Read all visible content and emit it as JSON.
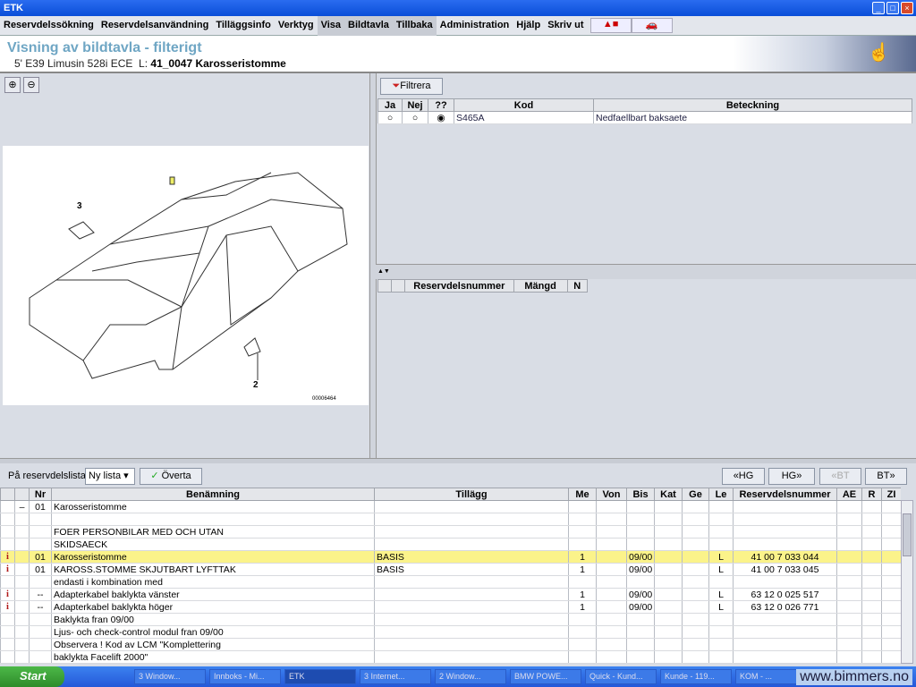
{
  "window": {
    "title": "ETK",
    "icon": "etk-app-icon"
  },
  "menu": [
    "Reservdelssökning",
    "Reservdelsanvändning",
    "Tilläggsinfo",
    "Verktyg",
    "Visa",
    "Bildtavla",
    "Tillbaka",
    "Administration",
    "Hjälp",
    "Skriv ut"
  ],
  "menu_highlighted": [
    "Visa",
    "Bildtavla",
    "Tillbaka"
  ],
  "toolbar_icons": [
    "warning-icon",
    "car-icon"
  ],
  "header": {
    "title": "Visning av bildtavla - filterigt",
    "model": "5' E39 Limusin 528i ECE",
    "group_prefix": "L:",
    "group": "41_0047 Karosseristomme"
  },
  "image": {
    "callouts": [
      "3",
      "2"
    ],
    "ref": "00006464"
  },
  "filter": {
    "button": "Filtrera",
    "columns": [
      "Ja",
      "Nej",
      "??",
      "Kod",
      "Beteckning"
    ],
    "rows": [
      {
        "selected": "??",
        "kod": "S465A",
        "beteckning": "Nedfaellbart baksaete"
      }
    ]
  },
  "parts_mini": {
    "columns": [
      "",
      "",
      "Reservdelsnummer",
      "Mängd",
      "N"
    ]
  },
  "bottom_toolbar": {
    "label": "På reservdelslista",
    "select": "Ny lista",
    "accept": "Överta",
    "nav": [
      "«HG",
      "HG»",
      "«BT",
      "BT»"
    ],
    "nav_disabled": [
      "«BT"
    ]
  },
  "table": {
    "columns": [
      "",
      "",
      "Nr",
      "Benämning",
      "Tillägg",
      "Me",
      "Von",
      "Bis",
      "Kat",
      "Ge",
      "Le",
      "Reservdelsnummer",
      "AE",
      "R",
      "ZI"
    ],
    "rows": [
      [
        "",
        "–",
        "01",
        "Karosseristomme",
        "",
        "",
        "",
        "",
        "",
        "",
        "",
        "",
        "",
        "",
        ""
      ],
      [
        "",
        "",
        "",
        "",
        "",
        "",
        "",
        "",
        "",
        "",
        "",
        "",
        "",
        "",
        ""
      ],
      [
        "",
        "",
        "",
        "FOER PERSONBILAR MED OCH UTAN",
        "",
        "",
        "",
        "",
        "",
        "",
        "",
        "",
        "",
        "",
        ""
      ],
      [
        "",
        "",
        "",
        "SKIDSAECK",
        "",
        "",
        "",
        "",
        "",
        "",
        "",
        "",
        "",
        "",
        ""
      ],
      [
        "i",
        "",
        "01",
        "Karosseristomme",
        "BASIS",
        "1",
        "",
        "09/00",
        "",
        "",
        "L",
        "41 00 7 033 044",
        "",
        "",
        ""
      ],
      [
        "i",
        "",
        "01",
        "KAROSS.STOMME SKJUTBART LYFTTAK",
        "BASIS",
        "1",
        "",
        "09/00",
        "",
        "",
        "L",
        "41 00 7 033 045",
        "",
        "",
        ""
      ],
      [
        "",
        "",
        "",
        "endasti i kombination med",
        "",
        "",
        "",
        "",
        "",
        "",
        "",
        "",
        "",
        "",
        ""
      ],
      [
        "i",
        "",
        "--",
        "Adapterkabel baklykta vänster",
        "",
        "1",
        "",
        "09/00",
        "",
        "",
        "L",
        "63 12 0 025 517",
        "",
        "",
        ""
      ],
      [
        "i",
        "",
        "--",
        "Adapterkabel baklykta höger",
        "",
        "1",
        "",
        "09/00",
        "",
        "",
        "L",
        "63 12 0 026 771",
        "",
        "",
        ""
      ],
      [
        "",
        "",
        "",
        "Baklykta fran 09/00",
        "",
        "",
        "",
        "",
        "",
        "",
        "",
        "",
        "",
        "",
        ""
      ],
      [
        "",
        "",
        "",
        "Ljus- och check-control modul fran 09/00",
        "",
        "",
        "",
        "",
        "",
        "",
        "",
        "",
        "",
        "",
        ""
      ],
      [
        "",
        "",
        "",
        "Observera ! Kod av LCM \"Komplettering",
        "",
        "",
        "",
        "",
        "",
        "",
        "",
        "",
        "",
        "",
        ""
      ],
      [
        "",
        "",
        "",
        "baklykta Facelift 2000\"",
        "",
        "",
        "",
        "",
        "",
        "",
        "",
        "",
        "",
        "",
        ""
      ]
    ],
    "selected_row": 4,
    "highlight_color": "#fbf38a"
  },
  "taskbar": {
    "start": "Start",
    "tasks": [
      "3 Window...",
      "Innboks - Mi...",
      "ETK",
      "3 Internet...",
      "2 Window...",
      "BMW POWE...",
      "Quick - Kund...",
      "Kunde - 119...",
      "KOM - ..."
    ],
    "watermark": "www.bimmers.no"
  }
}
